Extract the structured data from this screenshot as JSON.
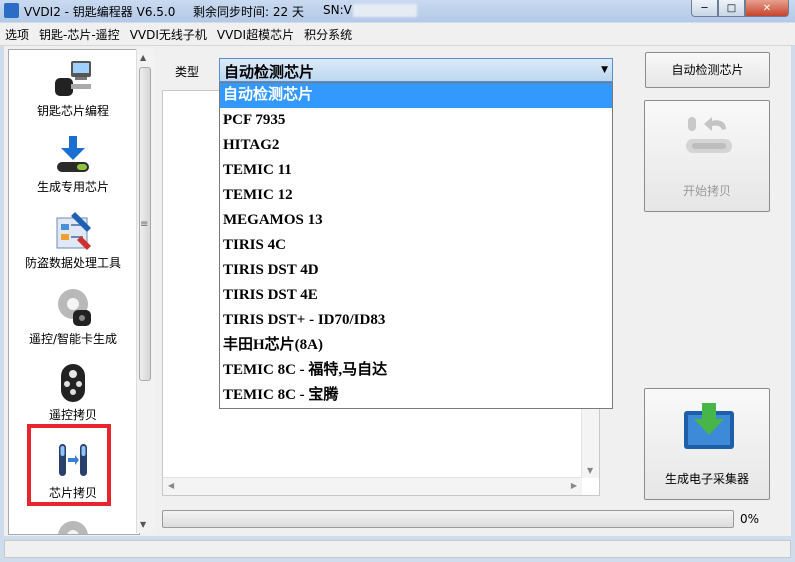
{
  "window": {
    "title": "VVDI2 - 钥匙编程器 V6.5.0",
    "sync_time": "剩余同步时间: 22 天",
    "sn_label": "SN:V",
    "close_glyph": "✕",
    "max_glyph": "□",
    "min_glyph": "─"
  },
  "menu": [
    "选项",
    "钥匙-芯片-遥控",
    "VVDI无线子机",
    "VVDI超模芯片",
    "积分系统"
  ],
  "sidebar": {
    "items": [
      {
        "label": "钥匙芯片编程",
        "icon": "key-programmer-icon"
      },
      {
        "label": "生成专用芯片",
        "icon": "chip-generate-icon"
      },
      {
        "label": "防盗数据处理工具",
        "icon": "immo-tools-icon"
      },
      {
        "label": "遥控/智能卡生成",
        "icon": "remote-gear-icon"
      },
      {
        "label": "遥控拷贝",
        "icon": "remote-copy-icon"
      },
      {
        "label": "芯片拷贝",
        "icon": "chip-copy-icon"
      }
    ],
    "highlight_color": "#e6262c"
  },
  "type": {
    "label": "类型",
    "selected": "自动检测芯片",
    "options": [
      "自动检测芯片",
      "PCF 7935",
      "HITAG2",
      "TEMIC 11",
      "TEMIC 12",
      "MEGAMOS 13",
      "TIRIS 4C",
      "TIRIS DST 4D",
      "TIRIS DST 4E",
      "TIRIS DST+ - ID70/ID83",
      "丰田H芯片(8A)",
      "TEMIC 8C - 福特,马自达",
      "TEMIC 8C - 宝腾"
    ]
  },
  "buttons": {
    "detect": "自动检测芯片",
    "start_copy": "开始拷贝",
    "generate_collector": "生成电子采集器"
  },
  "progress": {
    "value": 0,
    "text": "0%"
  },
  "colors": {
    "selection": "#3399ff",
    "titlebar": "#c9daf0"
  }
}
